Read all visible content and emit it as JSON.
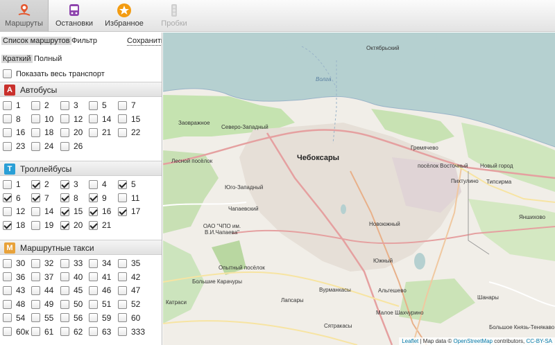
{
  "toolbar": {
    "tabs": [
      {
        "label": "Маршруты",
        "icon": "route-pin-icon"
      },
      {
        "label": "Остановки",
        "icon": "bus-stop-icon"
      },
      {
        "label": "Избранное",
        "icon": "star-icon"
      },
      {
        "label": "Пробки",
        "icon": "traffic-light-icon"
      }
    ]
  },
  "panel": {
    "nav": {
      "routes_list": "Список маршрутов",
      "filter": "Фильтр",
      "save": "Сохранить"
    },
    "mode": {
      "short": "Краткий",
      "full": "Полный"
    },
    "show_all": "Показать весь транспорт",
    "sections": [
      {
        "badge": "А",
        "title": "Автобусы",
        "color": "#c9302c",
        "routes": [
          {
            "n": "1",
            "on": false
          },
          {
            "n": "2",
            "on": false
          },
          {
            "n": "3",
            "on": false
          },
          {
            "n": "5",
            "on": false
          },
          {
            "n": "7",
            "on": false
          },
          {
            "n": "8",
            "on": false
          },
          {
            "n": "10",
            "on": false
          },
          {
            "n": "12",
            "on": false
          },
          {
            "n": "14",
            "on": false
          },
          {
            "n": "15",
            "on": false
          },
          {
            "n": "16",
            "on": false
          },
          {
            "n": "18",
            "on": false
          },
          {
            "n": "20",
            "on": false
          },
          {
            "n": "21",
            "on": false
          },
          {
            "n": "22",
            "on": false
          },
          {
            "n": "23",
            "on": false
          },
          {
            "n": "24",
            "on": false
          },
          {
            "n": "26",
            "on": false
          }
        ]
      },
      {
        "badge": "Т",
        "title": "Троллейбусы",
        "color": "#2a9fd6",
        "routes": [
          {
            "n": "1",
            "on": false
          },
          {
            "n": "2",
            "on": true
          },
          {
            "n": "3",
            "on": true
          },
          {
            "n": "4",
            "on": false
          },
          {
            "n": "5",
            "on": true
          },
          {
            "n": "6",
            "on": true
          },
          {
            "n": "7",
            "on": true
          },
          {
            "n": "8",
            "on": true
          },
          {
            "n": "9",
            "on": true
          },
          {
            "n": "11",
            "on": false
          },
          {
            "n": "12",
            "on": false
          },
          {
            "n": "14",
            "on": false
          },
          {
            "n": "15",
            "on": true
          },
          {
            "n": "16",
            "on": true
          },
          {
            "n": "17",
            "on": true
          },
          {
            "n": "18",
            "on": true
          },
          {
            "n": "19",
            "on": false
          },
          {
            "n": "20",
            "on": true
          },
          {
            "n": "21",
            "on": true
          }
        ]
      },
      {
        "badge": "М",
        "title": "Маршрутные такси",
        "color": "#e8a23a",
        "routes": [
          {
            "n": "30",
            "on": false
          },
          {
            "n": "32",
            "on": false
          },
          {
            "n": "33",
            "on": false
          },
          {
            "n": "34",
            "on": false
          },
          {
            "n": "35",
            "on": false
          },
          {
            "n": "36",
            "on": false
          },
          {
            "n": "37",
            "on": false
          },
          {
            "n": "40",
            "on": false
          },
          {
            "n": "41",
            "on": false
          },
          {
            "n": "42",
            "on": false
          },
          {
            "n": "43",
            "on": false
          },
          {
            "n": "44",
            "on": false
          },
          {
            "n": "45",
            "on": false
          },
          {
            "n": "46",
            "on": false
          },
          {
            "n": "47",
            "on": false
          },
          {
            "n": "48",
            "on": false
          },
          {
            "n": "49",
            "on": false
          },
          {
            "n": "50",
            "on": false
          },
          {
            "n": "51",
            "on": false
          },
          {
            "n": "52",
            "on": false
          },
          {
            "n": "54",
            "on": false
          },
          {
            "n": "55",
            "on": false
          },
          {
            "n": "56",
            "on": false
          },
          {
            "n": "59",
            "on": false
          },
          {
            "n": "60",
            "on": false
          },
          {
            "n": "60к",
            "on": false
          },
          {
            "n": "61",
            "on": false
          },
          {
            "n": "62",
            "on": false
          },
          {
            "n": "63",
            "on": false
          },
          {
            "n": "333",
            "on": false
          }
        ]
      }
    ]
  },
  "map": {
    "labels": [
      {
        "t": "Октябрьский",
        "name": "label-oktyabrsky"
      },
      {
        "t": "Волга",
        "name": "label-volga"
      },
      {
        "t": "Заовражное",
        "name": "label-zaovrazhnoe"
      },
      {
        "t": "Северо-Западный",
        "name": "label-severo-zapadny"
      },
      {
        "t": "Лесной посёлок",
        "name": "label-lesnoy"
      },
      {
        "t": "Чебоксары",
        "name": "label-cheboksary",
        "city": true
      },
      {
        "t": "Гремячево",
        "name": "label-gremyachevo"
      },
      {
        "t": "посёлок Восточный",
        "name": "label-vostochny"
      },
      {
        "t": "Новый город",
        "name": "label-novy-gorod"
      },
      {
        "t": "Юго-Западный",
        "name": "label-yugo-zapadny"
      },
      {
        "t": "Пихтулино",
        "name": "label-pikhtulino"
      },
      {
        "t": "Типсирма",
        "name": "label-tipsirma"
      },
      {
        "t": "Чапаевский",
        "name": "label-chapaevsky"
      },
      {
        "t": "Новоюжный",
        "name": "label-novoyuzhny"
      },
      {
        "t": "Яншихово",
        "name": "label-yanshikhovo"
      },
      {
        "t": "ОАО \"ЧПО им. В.И.Чапаева\"",
        "name": "label-chpo"
      },
      {
        "t": "Южный",
        "name": "label-yuzhny"
      },
      {
        "t": "Опытный посёлок",
        "name": "label-opytny"
      },
      {
        "t": "Большие Карачуры",
        "name": "label-karachury"
      },
      {
        "t": "Вурманкасы",
        "name": "label-vurmankasy"
      },
      {
        "t": "Альгешево",
        "name": "label-algeshevo"
      },
      {
        "t": "Катраси",
        "name": "label-katrasi"
      },
      {
        "t": "Лапсары",
        "name": "label-lapsary"
      },
      {
        "t": "Малое Шахчурино",
        "name": "label-shakhchurino"
      },
      {
        "t": "Шанары",
        "name": "label-shanary"
      },
      {
        "t": "Сятракасы",
        "name": "label-syatrakasy"
      },
      {
        "t": "Большое Князь-Тенякаво",
        "name": "label-tenyakovo"
      }
    ],
    "attribution": {
      "leaflet": "Leaflet",
      "mapdata": "| Map data ©",
      "osm": "OpenStreetMap",
      "contrib": "contributors,",
      "license": "CC-BY-SA"
    },
    "zoom": {
      "in": "+",
      "out": "−"
    }
  }
}
